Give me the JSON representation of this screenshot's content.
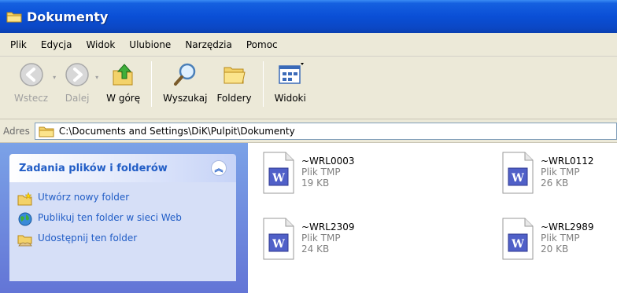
{
  "window": {
    "title": "Dokumenty"
  },
  "menu": [
    "Plik",
    "Edycja",
    "Widok",
    "Ulubione",
    "Narzędzia",
    "Pomoc"
  ],
  "toolbar": {
    "back": "Wstecz",
    "forward": "Dalej",
    "up": "W górę",
    "search": "Wyszukaj",
    "folders": "Foldery",
    "views": "Widoki"
  },
  "address": {
    "label": "Adres",
    "path": "C:\\Documents and Settings\\DiK\\Pulpit\\Dokumenty"
  },
  "tasks": {
    "title": "Zadania plików i folderów",
    "items": [
      {
        "label": "Utwórz nowy folder",
        "icon": "new-folder-icon"
      },
      {
        "label": "Publikuj ten folder w sieci Web",
        "icon": "publish-web-icon"
      },
      {
        "label": "Udostępnij ten folder",
        "icon": "share-folder-icon"
      }
    ]
  },
  "files": [
    {
      "name": "~WRL0003",
      "type": "Plik TMP",
      "size": "19 KB"
    },
    {
      "name": "~WRL0112",
      "type": "Plik TMP",
      "size": "26 KB"
    },
    {
      "name": "~WRL2309",
      "type": "Plik TMP",
      "size": "24 KB"
    },
    {
      "name": "~WRL2989",
      "type": "Plik TMP",
      "size": "20 KB"
    }
  ]
}
